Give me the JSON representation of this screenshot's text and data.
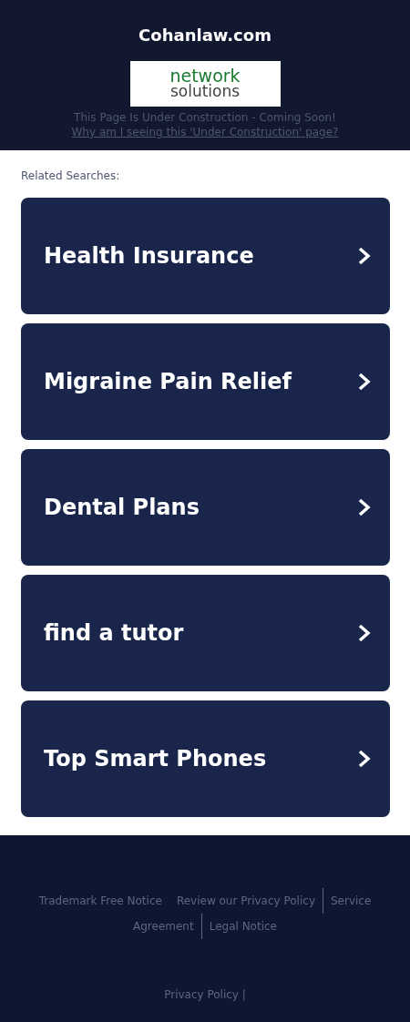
{
  "header": {
    "title": "Cohanlaw.com",
    "logo": {
      "line_1": "network",
      "line_2": "solutions"
    },
    "notice": "This Page Is Under Construction - Coming Soon!",
    "link": "Why am I seeing this 'Under Construction' page?"
  },
  "related": {
    "heading": "Related Searches:",
    "items": [
      {
        "label": "Health Insurance"
      },
      {
        "label": "Migraine Pain Relief"
      },
      {
        "label": "Dental Plans"
      },
      {
        "label": "find a tutor"
      },
      {
        "label": "Top Smart Phones"
      }
    ]
  },
  "footer": {
    "rows": [
      [
        {
          "label": "Trademark Free Notice",
          "divider": false
        },
        {
          "label": "Review our Privacy Policy",
          "divider": false
        },
        {
          "label": "Service",
          "divider": true
        }
      ],
      [
        {
          "label": "Agreement",
          "divider": false
        },
        {
          "label": "Legal Notice",
          "divider": true
        }
      ]
    ],
    "bottom": "Privacy Policy |"
  }
}
